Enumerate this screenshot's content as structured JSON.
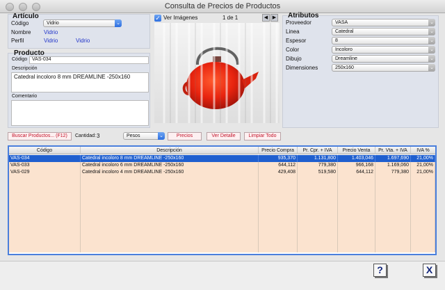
{
  "window": {
    "title": "Consulta de Precios de Productos"
  },
  "articulo": {
    "heading": "Artículo",
    "codigo_label": "Código",
    "codigo_value": "Vidrio",
    "nombre_label": "Nombre",
    "nombre_value": "Vidrio",
    "perfil_label": "Perfil",
    "perfil_value1": "Vidrio",
    "perfil_value2": "Vidrio"
  },
  "producto": {
    "heading": "Producto",
    "codigo_label": "Código",
    "codigo_value": "VAS-034",
    "descripcion_label": "Descripción",
    "descripcion_value": "Catedral incoloro 8 mm DREAMLINE  -250x160",
    "comentario_label": "Comentario",
    "comentario_value": ""
  },
  "imagen": {
    "ver_label": "Ver Imágenes",
    "checked": true,
    "counter": "1 de 1",
    "prev_icon": "triangle-left-icon",
    "next_icon": "triangle-right-icon"
  },
  "atributos": {
    "heading": "Atributos",
    "items": [
      {
        "label": "Proveedor",
        "value": "VASA"
      },
      {
        "label": "Linea",
        "value": "Catedral"
      },
      {
        "label": "Espesor",
        "value": "8"
      },
      {
        "label": "Color",
        "value": "Incoloro"
      },
      {
        "label": "Dibujo",
        "value": "Dreamline"
      },
      {
        "label": "Dimensiones",
        "value": "250x160"
      }
    ]
  },
  "actions": {
    "buscar": "Buscar Productos... (F12)",
    "cantidad_label": "Cantidad:",
    "cantidad_value": "3",
    "moneda": "Pesos",
    "precios": "Precios",
    "ver_detalle": "Ver Detalle",
    "limpiar": "Limpiar Todo"
  },
  "table": {
    "headers": [
      "Código",
      "Descripción",
      "Precio Compra",
      "Pr. Cpr. + IVA",
      "Precio Venta",
      "Pr. Vta. + IVA",
      "IVA %"
    ],
    "rows": [
      [
        "VAS-034",
        "Catedral incoloro 8 mm DREAMLINE  -250x160",
        "935,370",
        "1.131,800",
        "1.403,046",
        "1.697,690",
        "21,00%"
      ],
      [
        "VAS-033",
        "Catedral incoloro 6 mm DREAMLINE  -250x160",
        "644,112",
        "779,380",
        "966,168",
        "1.169,060",
        "21,00%"
      ],
      [
        "VAS-029",
        "Catedral incoloro 4 mm DREAMLINE  -250x160",
        "429,408",
        "519,580",
        "644,112",
        "779,380",
        "21,00%"
      ]
    ],
    "selected_row": 0
  },
  "footer": {
    "help_icon": "question-icon",
    "help_label": "?",
    "close_icon": "close-icon",
    "close_label": "X"
  },
  "colors": {
    "accent": "#1f5fcf",
    "row_alt": "#fbe3cf",
    "button_text": "#c3142a",
    "link": "#2134c9"
  }
}
